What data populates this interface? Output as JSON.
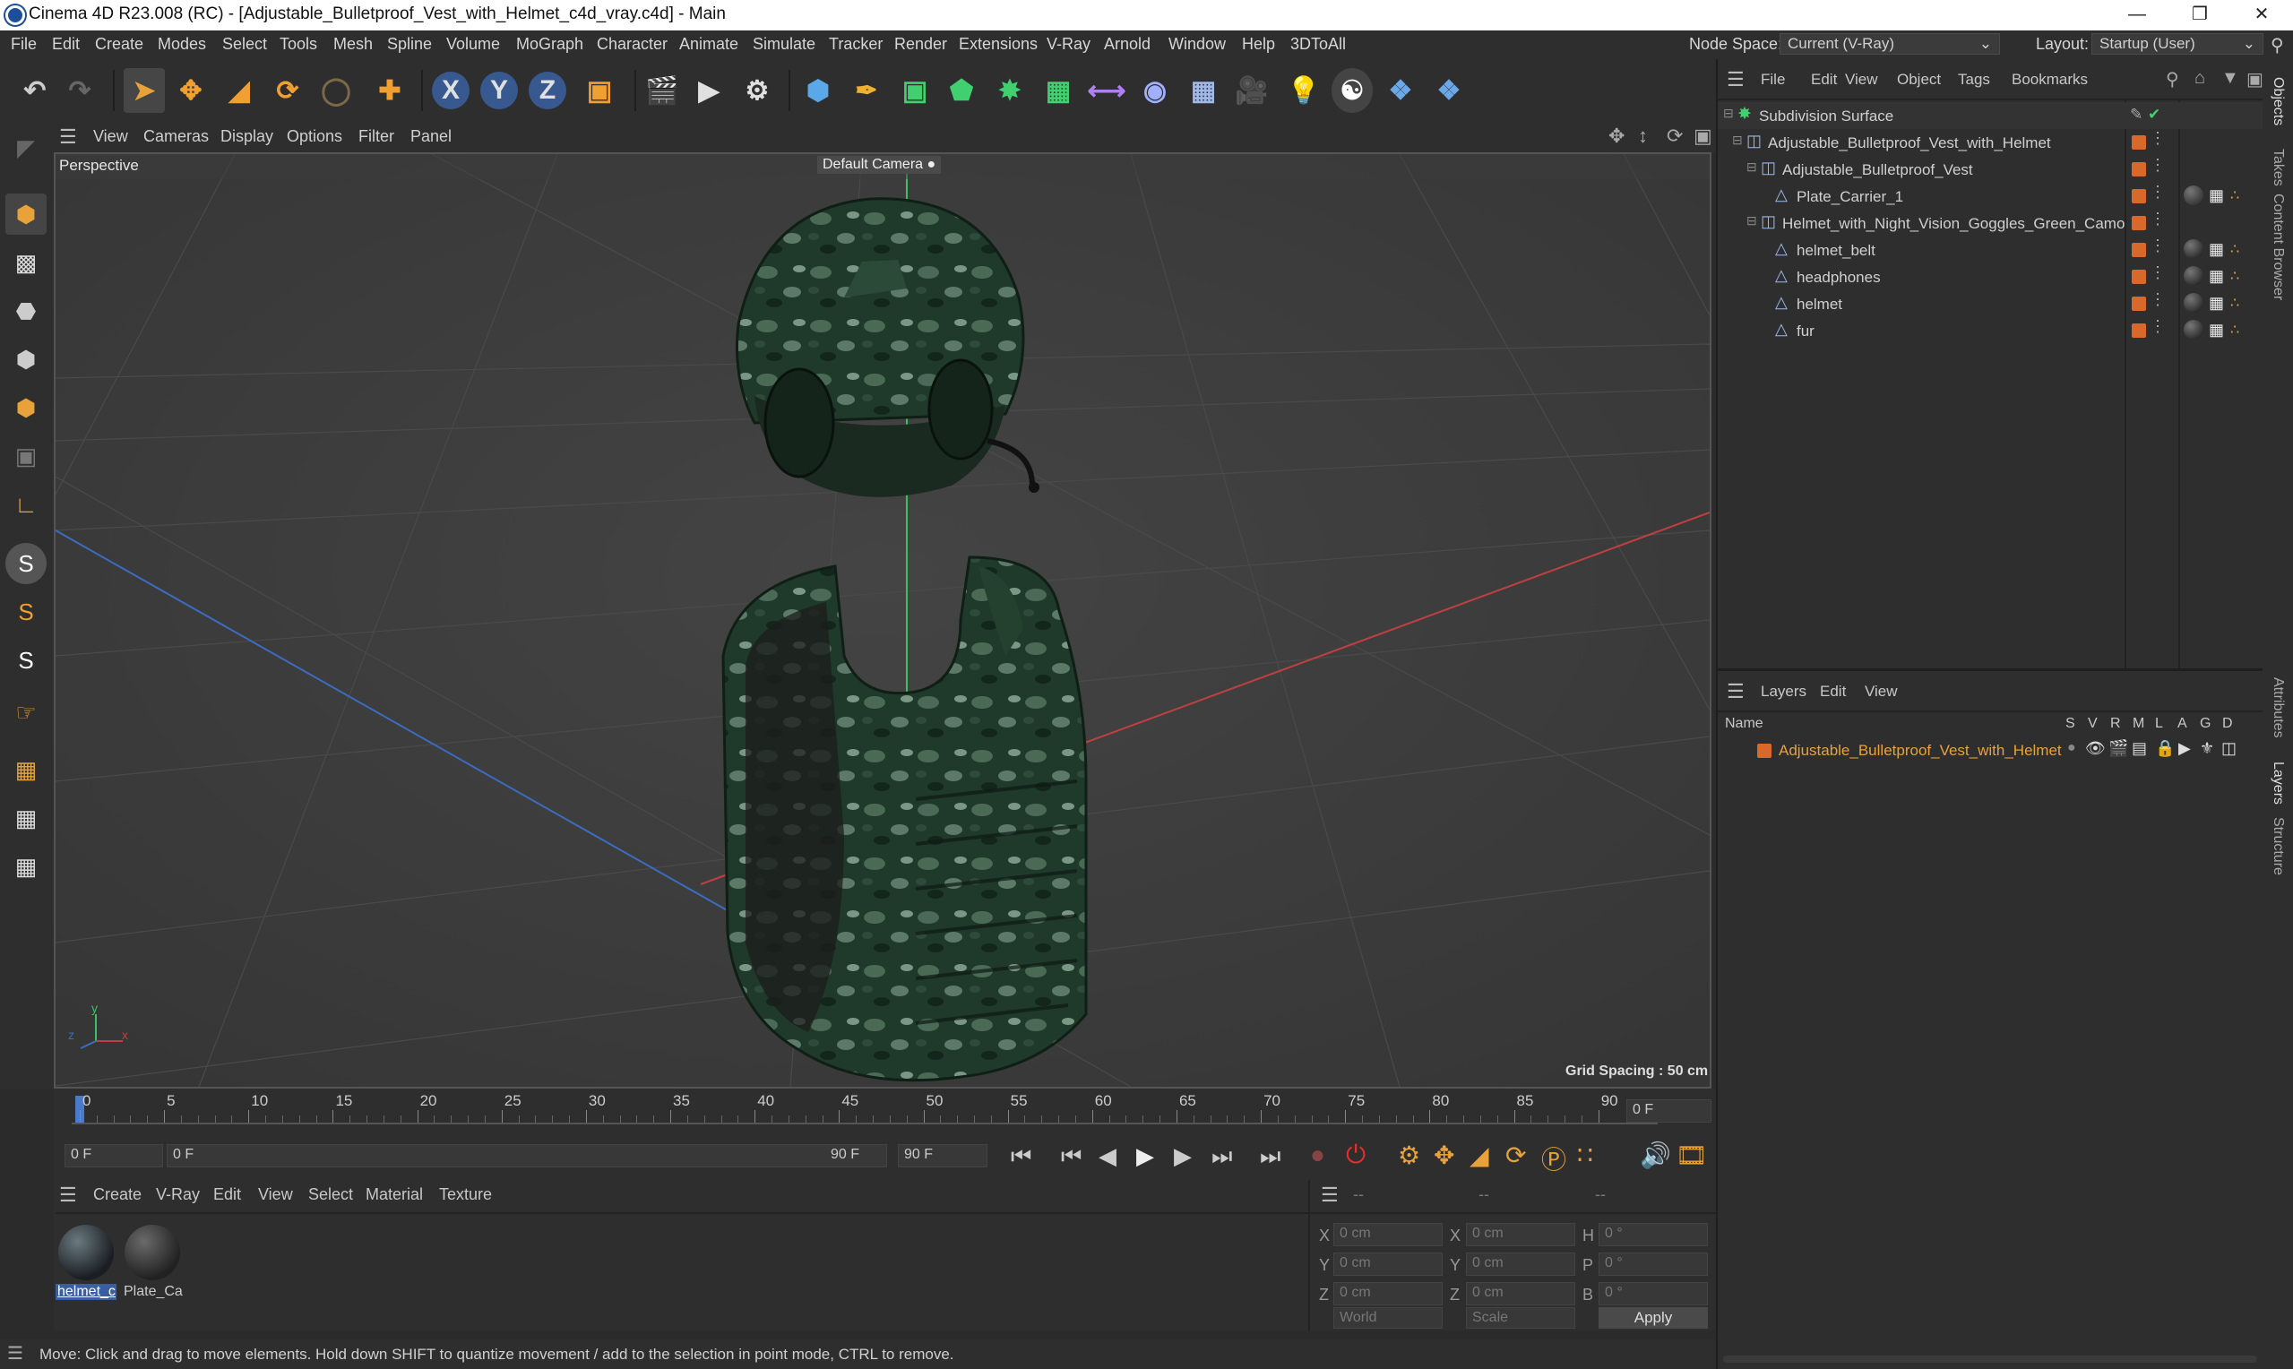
{
  "titlebar": {
    "title": "Cinema 4D R23.008 (RC) - [Adjustable_Bulletproof_Vest_with_Helmet_c4d_vray.c4d] - Main",
    "minimize": "—",
    "maximize": "❐",
    "close": "✕"
  },
  "menubar": {
    "items": [
      "File",
      "Edit",
      "Create",
      "Modes",
      "Select",
      "Tools",
      "Mesh",
      "Spline",
      "Volume",
      "MoGraph",
      "Character",
      "Animate",
      "Simulate",
      "Tracker",
      "Render",
      "Extensions",
      "V-Ray",
      "Arnold",
      "Window",
      "Help",
      "3DToAll"
    ],
    "node_space_label": "Node Space:",
    "node_space_value": "Current (V-Ray)",
    "layout_label": "Layout:",
    "layout_value": "Startup (User)"
  },
  "viewport": {
    "menu": [
      "View",
      "Cameras",
      "Display",
      "Options",
      "Filter",
      "Panel"
    ],
    "view_name": "Perspective",
    "camera_label": "Default Camera",
    "grid_spacing": "Grid Spacing : 50 cm",
    "axis_y": "y",
    "axis_x": "x",
    "axis_z": "z"
  },
  "timeline": {
    "ticks": [
      "0",
      "5",
      "10",
      "15",
      "20",
      "25",
      "30",
      "35",
      "40",
      "45",
      "50",
      "55",
      "60",
      "65",
      "70",
      "75",
      "80",
      "85",
      "90"
    ],
    "current_frame": "0 F",
    "start_frame": "0 F",
    "range_start": "0 F",
    "range_end": "90 F",
    "end_frame": "90 F"
  },
  "materials": {
    "menu": [
      "Create",
      "V-Ray",
      "Edit",
      "View",
      "Select",
      "Material",
      "Texture"
    ],
    "items": [
      {
        "label": "helmet_c"
      },
      {
        "label": "Plate_Ca"
      }
    ]
  },
  "coords": {
    "header1": "--",
    "header2": "--",
    "header3": "--",
    "rows": [
      {
        "a": "X",
        "av": "0 cm",
        "b": "X",
        "bv": "0 cm",
        "c": "H",
        "cv": "0 °"
      },
      {
        "a": "Y",
        "av": "0 cm",
        "b": "Y",
        "bv": "0 cm",
        "c": "P",
        "cv": "0 °"
      },
      {
        "a": "Z",
        "av": "0 cm",
        "b": "Z",
        "bv": "0 cm",
        "c": "B",
        "cv": "0 °"
      }
    ],
    "space": "World",
    "mode": "Scale",
    "apply": "Apply"
  },
  "status": "Move: Click and drag to move elements. Hold down SHIFT to quantize movement / add to the selection in point mode, CTRL to remove.",
  "objects": {
    "menu": [
      "File",
      "Edit",
      "View",
      "Object",
      "Tags",
      "Bookmarks"
    ],
    "tree": [
      {
        "name": "Subdivision Surface",
        "indent": 0
      },
      {
        "name": "Adjustable_Bulletproof_Vest_with_Helmet",
        "indent": 1
      },
      {
        "name": "Adjustable_Bulletproof_Vest",
        "indent": 2
      },
      {
        "name": "Plate_Carrier_1",
        "indent": 3
      },
      {
        "name": "Helmet_with_Night_Vision_Goggles_Green_Camo",
        "indent": 2
      },
      {
        "name": "helmet_belt",
        "indent": 3
      },
      {
        "name": "headphones",
        "indent": 3
      },
      {
        "name": "helmet",
        "indent": 3
      },
      {
        "name": "fur",
        "indent": 3
      }
    ]
  },
  "layers": {
    "menu": [
      "Layers",
      "Edit",
      "View"
    ],
    "name_header": "Name",
    "flags": [
      "S",
      "V",
      "R",
      "M",
      "L",
      "A",
      "G",
      "D"
    ],
    "items": [
      {
        "name": "Adjustable_Bulletproof_Vest_with_Helmet"
      }
    ]
  },
  "right_tabs": [
    "Objects",
    "Takes",
    "Content Browser",
    "Attributes",
    "Layers",
    "Structure"
  ],
  "colors": {
    "accent_orange": "#d9692a",
    "axis_red": "#c04040",
    "axis_blue": "#3c6cc0",
    "axis_green": "#3fc060",
    "selected_blue": "#3a5f9e"
  }
}
